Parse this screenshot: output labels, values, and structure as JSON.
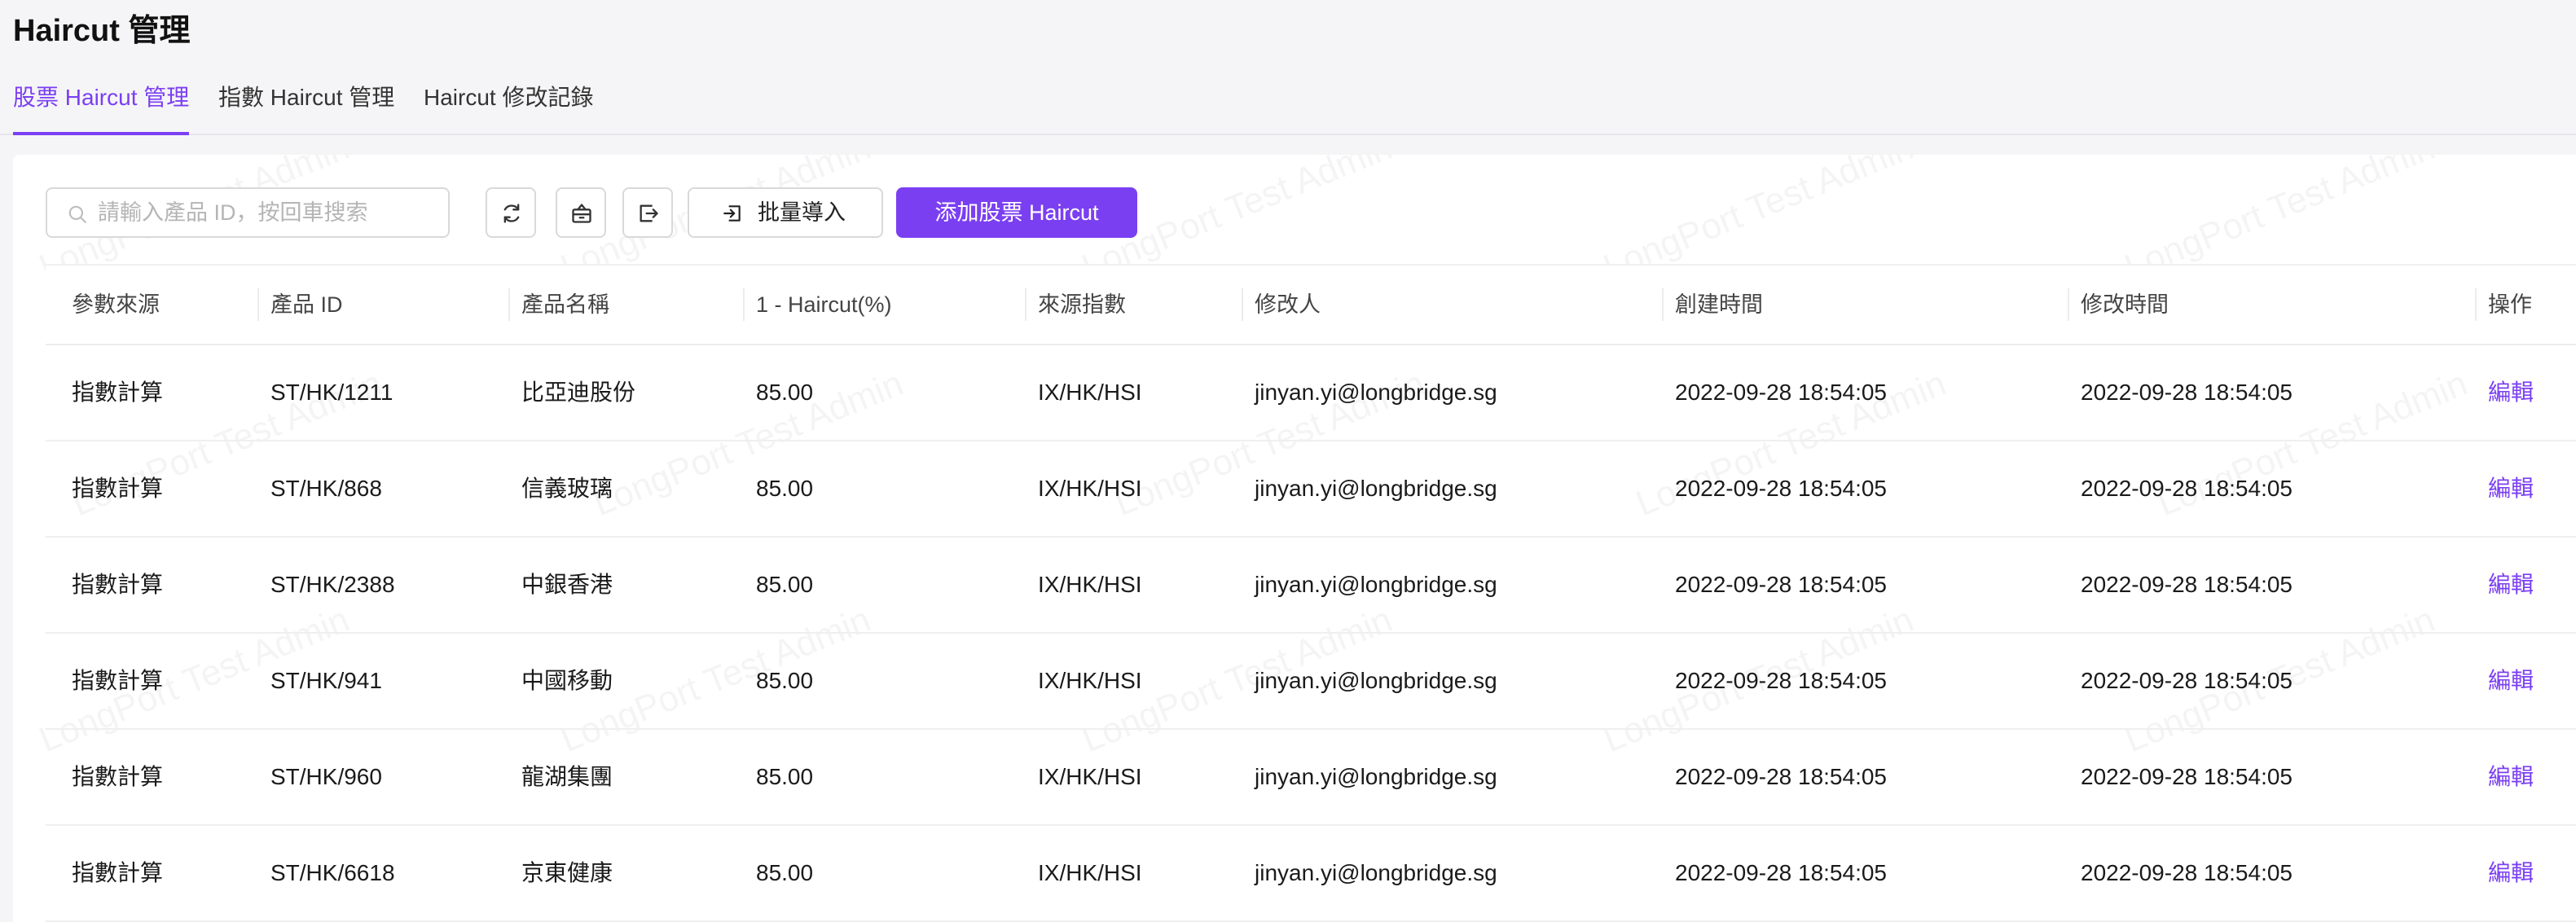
{
  "page": {
    "title": "Haircut 管理"
  },
  "tabs": [
    {
      "label": "股票 Haircut 管理",
      "active": true
    },
    {
      "label": "指數 Haircut 管理",
      "active": false
    },
    {
      "label": "Haircut 修改記錄",
      "active": false
    }
  ],
  "toolbar": {
    "search_placeholder": "請輸入產品 ID，按回車搜索",
    "search_value": "",
    "icons": [
      "refresh-icon",
      "basket-icon",
      "export-icon"
    ],
    "import_label": "批量導入",
    "add_label": "添加股票 Haircut"
  },
  "table": {
    "columns": [
      "參數來源",
      "產品 ID",
      "產品名稱",
      "1 - Haircut(%)",
      "來源指數",
      "修改人",
      "創建時間",
      "修改時間",
      "操作"
    ],
    "rows": [
      {
        "source": "指數計算",
        "product_id": "ST/HK/1211",
        "product_name": "比亞迪股份",
        "haircut": "85.00",
        "index": "IX/HK/HSI",
        "modifier": "jinyan.yi@longbridge.sg",
        "created": "2022-09-28 18:54:05",
        "updated": "2022-09-28 18:54:05",
        "action": "編輯"
      },
      {
        "source": "指數計算",
        "product_id": "ST/HK/868",
        "product_name": "信義玻璃",
        "haircut": "85.00",
        "index": "IX/HK/HSI",
        "modifier": "jinyan.yi@longbridge.sg",
        "created": "2022-09-28 18:54:05",
        "updated": "2022-09-28 18:54:05",
        "action": "編輯"
      },
      {
        "source": "指數計算",
        "product_id": "ST/HK/2388",
        "product_name": "中銀香港",
        "haircut": "85.00",
        "index": "IX/HK/HSI",
        "modifier": "jinyan.yi@longbridge.sg",
        "created": "2022-09-28 18:54:05",
        "updated": "2022-09-28 18:54:05",
        "action": "編輯"
      },
      {
        "source": "指數計算",
        "product_id": "ST/HK/941",
        "product_name": "中國移動",
        "haircut": "85.00",
        "index": "IX/HK/HSI",
        "modifier": "jinyan.yi@longbridge.sg",
        "created": "2022-09-28 18:54:05",
        "updated": "2022-09-28 18:54:05",
        "action": "編輯"
      },
      {
        "source": "指數計算",
        "product_id": "ST/HK/960",
        "product_name": "龍湖集團",
        "haircut": "85.00",
        "index": "IX/HK/HSI",
        "modifier": "jinyan.yi@longbridge.sg",
        "created": "2022-09-28 18:54:05",
        "updated": "2022-09-28 18:54:05",
        "action": "編輯"
      },
      {
        "source": "指數計算",
        "product_id": "ST/HK/6618",
        "product_name": "京東健康",
        "haircut": "85.00",
        "index": "IX/HK/HSI",
        "modifier": "jinyan.yi@longbridge.sg",
        "created": "2022-09-28 18:54:05",
        "updated": "2022-09-28 18:54:05",
        "action": "編輯"
      }
    ]
  },
  "watermark": {
    "text": "LongPort Test Admin"
  },
  "colors": {
    "accent": "#7b3ff2",
    "background": "#f5f5f7"
  }
}
